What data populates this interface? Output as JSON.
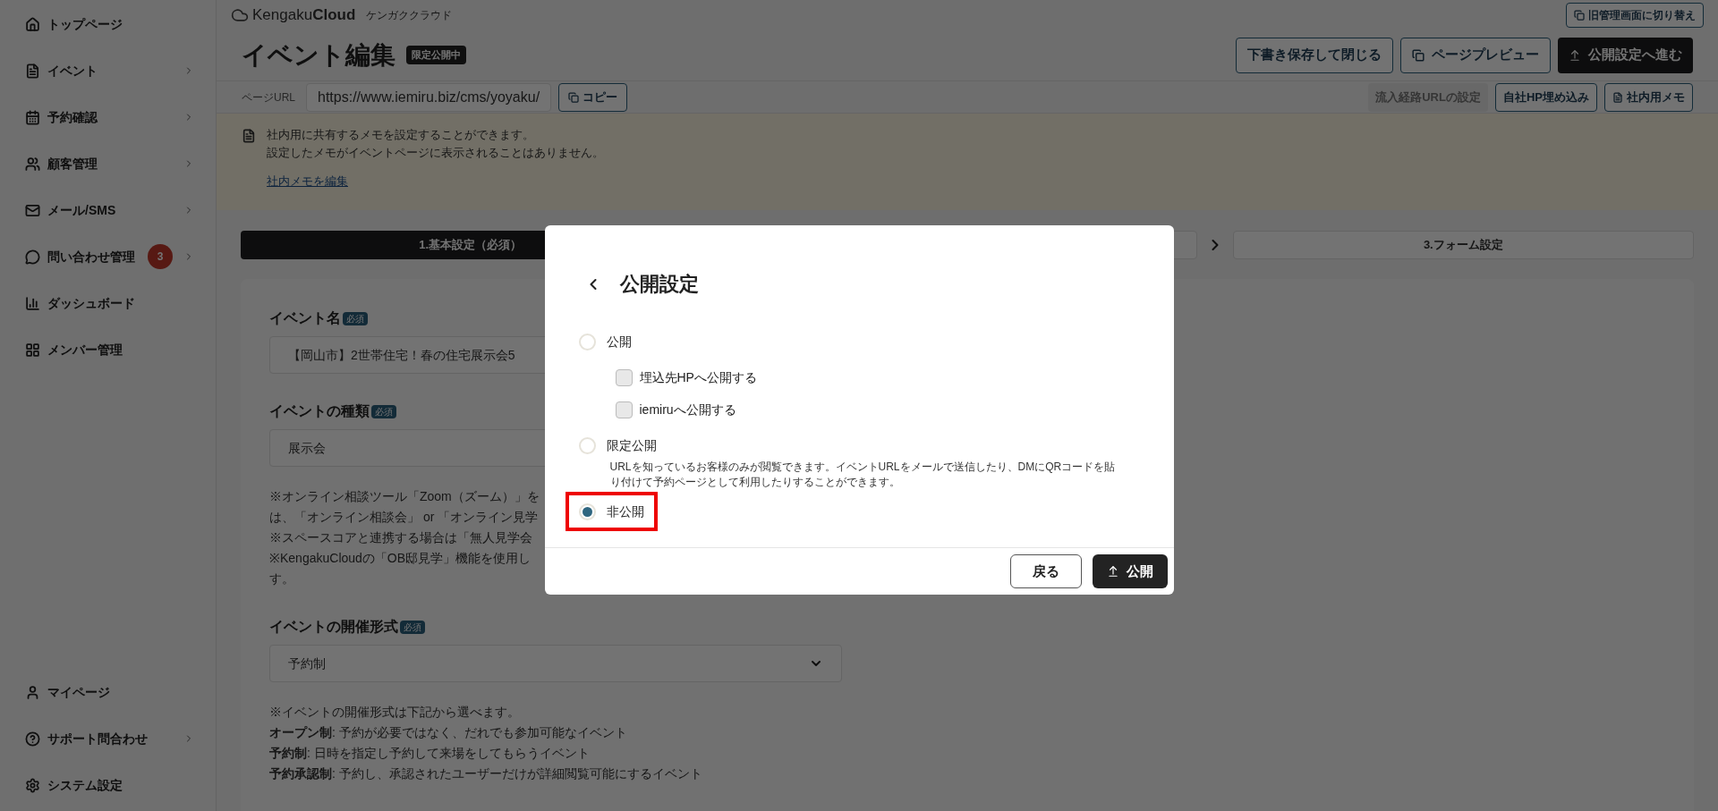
{
  "sidebar": {
    "items": [
      {
        "label": "トップページ",
        "submenu": false
      },
      {
        "label": "イベント",
        "submenu": true
      },
      {
        "label": "予約確認",
        "submenu": true
      },
      {
        "label": "顧客管理",
        "submenu": true
      },
      {
        "label": "メール/SMS",
        "submenu": true
      },
      {
        "label": "問い合わせ管理",
        "submenu": true,
        "badge": "3"
      },
      {
        "label": "ダッシュボード",
        "submenu": false
      },
      {
        "label": "メンバー管理",
        "submenu": false
      }
    ],
    "bottom_items": [
      {
        "label": "マイページ",
        "submenu": false
      },
      {
        "label": "サポート問合わせ",
        "submenu": true
      },
      {
        "label": "システム設定",
        "submenu": false
      }
    ]
  },
  "topbar": {
    "logo": "Kengaku**Cloud**",
    "logo_reading": "ケンガククラウド",
    "switch_button": "旧管理画面に切り替え"
  },
  "header": {
    "title": "イベント編集",
    "status_badge": "限定公開中",
    "buttons": [
      {
        "label": "下書き保存して閉じる",
        "kind": "outline"
      },
      {
        "label": "ページプレビュー",
        "kind": "preview"
      },
      {
        "label": "公開設定へ進む",
        "kind": "primary"
      }
    ]
  },
  "url_bar": {
    "label": "ページURL",
    "value": "https://www.iemiru.biz/cms/yoyaku/",
    "copy_button": "コピー",
    "actions": [
      {
        "label": "流入経路URLの設定",
        "disabled": true,
        "kind": "plain"
      },
      {
        "label": "自社HP埋め込み",
        "disabled": false,
        "kind": "plain"
      },
      {
        "label": "社内用メモ",
        "disabled": false,
        "kind": "memo"
      }
    ]
  },
  "memo_notice": {
    "lines": [
      "社内用に共有するメモを設定することができます。",
      "設定したメモがイベントページに表示されることはありません。"
    ],
    "link": "社内メモを編集"
  },
  "steps": [
    {
      "label": "1.基本設定（必須）",
      "selected": true
    },
    {
      "selected": false
    },
    {
      "label": "3.フォーム設定",
      "selected": false
    }
  ],
  "form": {
    "fields": [
      {
        "label": "イベント名",
        "required_badge": "必須",
        "value": "【岡山市】2世帯住宅！春の住宅展示会5",
        "kind": "text"
      },
      {
        "label": "イベントの種類",
        "required_badge": "必須",
        "value": "展示会",
        "kind": "text",
        "notes": [
          "※オンライン相談ツール「Zoom（ズーム）」を",
          "は、「オンライン相談会」 or 「オンライン見学",
          "※スペースコアと連携する場合は「無人見学会",
          "※KengakuCloudの「OB邸見学」機能を使用し",
          "す。"
        ]
      },
      {
        "label": "イベントの開催形式",
        "required_badge": "必須",
        "value": "予約制",
        "kind": "select",
        "notes": [
          "※イベントの開催形式は下記から選べます。",
          "**オープン制**: 予約が必要ではなく、だれでも参加可能なイベント",
          "**予約制**: 日時を指定し予約して来場をしてもらうイベント",
          "**予約承認制**: 予約し、承認されたユーザーだけが詳細閲覧可能にするイベント"
        ]
      }
    ]
  },
  "modal": {
    "title": "公開設定",
    "options": [
      {
        "label": "公開",
        "selected": false,
        "highlighted": false,
        "children": [
          {
            "label": "埋込先HPへ公開する",
            "checked": false
          },
          {
            "label": "iemiruへ公開する",
            "checked": false
          }
        ]
      },
      {
        "label": "限定公開",
        "selected": false,
        "highlighted": false,
        "description": "URLを知っているお客様のみが閲覧できます。イベントURLをメールで送信したり、DMにQRコードを貼り付けて予約ページとして利用したりすることができます。"
      },
      {
        "label": "非公開",
        "selected": true,
        "highlighted": true
      }
    ],
    "buttons": [
      {
        "label": "戻る",
        "kind": "secondary"
      },
      {
        "label": "公開",
        "kind": "primary"
      }
    ]
  }
}
